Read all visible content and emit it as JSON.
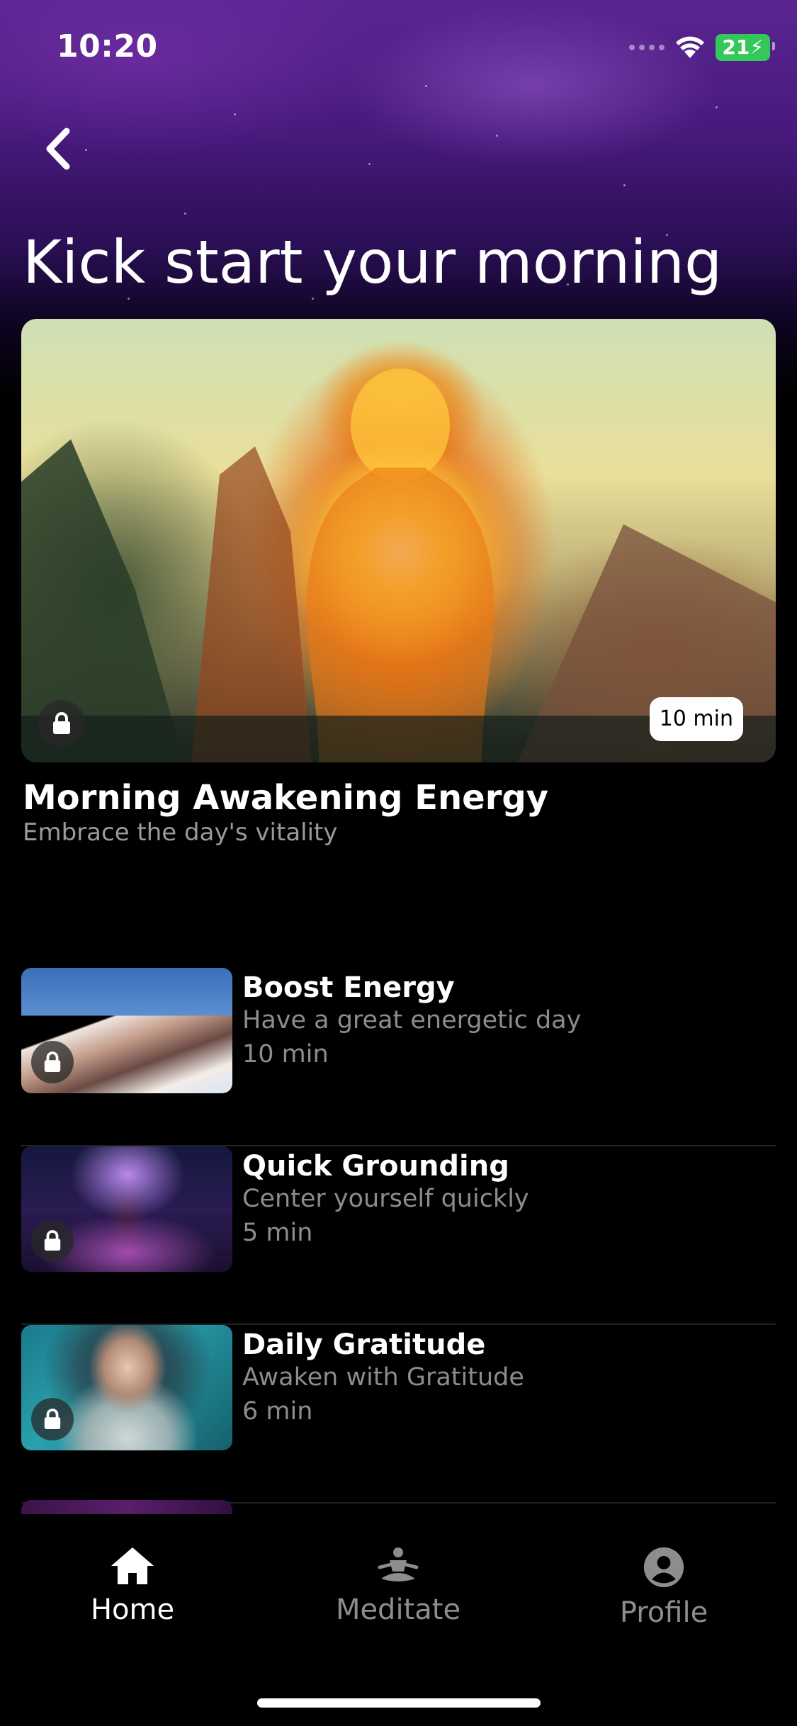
{
  "status_bar": {
    "time": "10:20",
    "battery": "21"
  },
  "page_title": "Kick start your morning",
  "featured": {
    "title": "Morning Awakening Energy",
    "subtitle": "Embrace the day's vitality",
    "duration": "10 min",
    "locked": true
  },
  "sessions": [
    {
      "title": "Boost Energy",
      "subtitle": "Have a great energetic day",
      "duration": "10 min",
      "locked": true
    },
    {
      "title": "Quick Grounding",
      "subtitle": "Center yourself quickly",
      "duration": "5 min",
      "locked": true
    },
    {
      "title": "Daily Gratitude",
      "subtitle": "Awaken with Gratitude",
      "duration": "6 min",
      "locked": true
    }
  ],
  "tabbar": {
    "home": "Home",
    "meditate": "Meditate",
    "profile": "Profile",
    "active": "Home"
  },
  "icons": [
    "back-chevron-icon",
    "lock-icon",
    "wifi-icon",
    "home-icon",
    "meditate-icon",
    "profile-icon"
  ],
  "colors": {
    "background": "#000000",
    "battery": "#34c759",
    "inactive_tab": "#8d8d8d"
  }
}
